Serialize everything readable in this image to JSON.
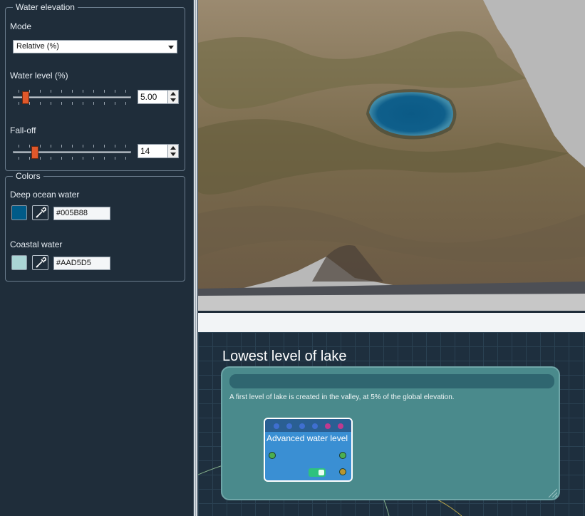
{
  "water_elevation": {
    "title": "Water elevation",
    "mode_label": "Mode",
    "mode_value": "Relative (%)",
    "water_level_label": "Water level (%)",
    "water_level_value": "5.00",
    "water_level_fraction": 0.05,
    "falloff_label": "Fall-off",
    "falloff_value": "14",
    "falloff_fraction": 0.14
  },
  "colors": {
    "title": "Colors",
    "deep_label": "Deep ocean water",
    "deep_hex": "#005B88",
    "coastal_label": "Coastal water",
    "coastal_hex": "#AAD5D5",
    "picker_icon": "eyedropper-icon"
  },
  "graph": {
    "note_title": "Lowest level of lake",
    "note_text": "A first level of lake is created in the valley, at 5% of the global elevation.",
    "node_title": "Advanced water level",
    "node_header_ports": [
      "#3f6fd0",
      "#3f6fd0",
      "#3f6fd0",
      "#3f6fd0",
      "#c0398f",
      "#c0398f"
    ],
    "node_toggle_on": true
  },
  "theme": {
    "panel_bg": "#1f2d3a",
    "slider_handle": "#e0582b",
    "water": "#0b5a86",
    "terrain": "#8b7a5e",
    "node_bg": "#3a8fd3",
    "note_bg": "#4a8a8c"
  }
}
